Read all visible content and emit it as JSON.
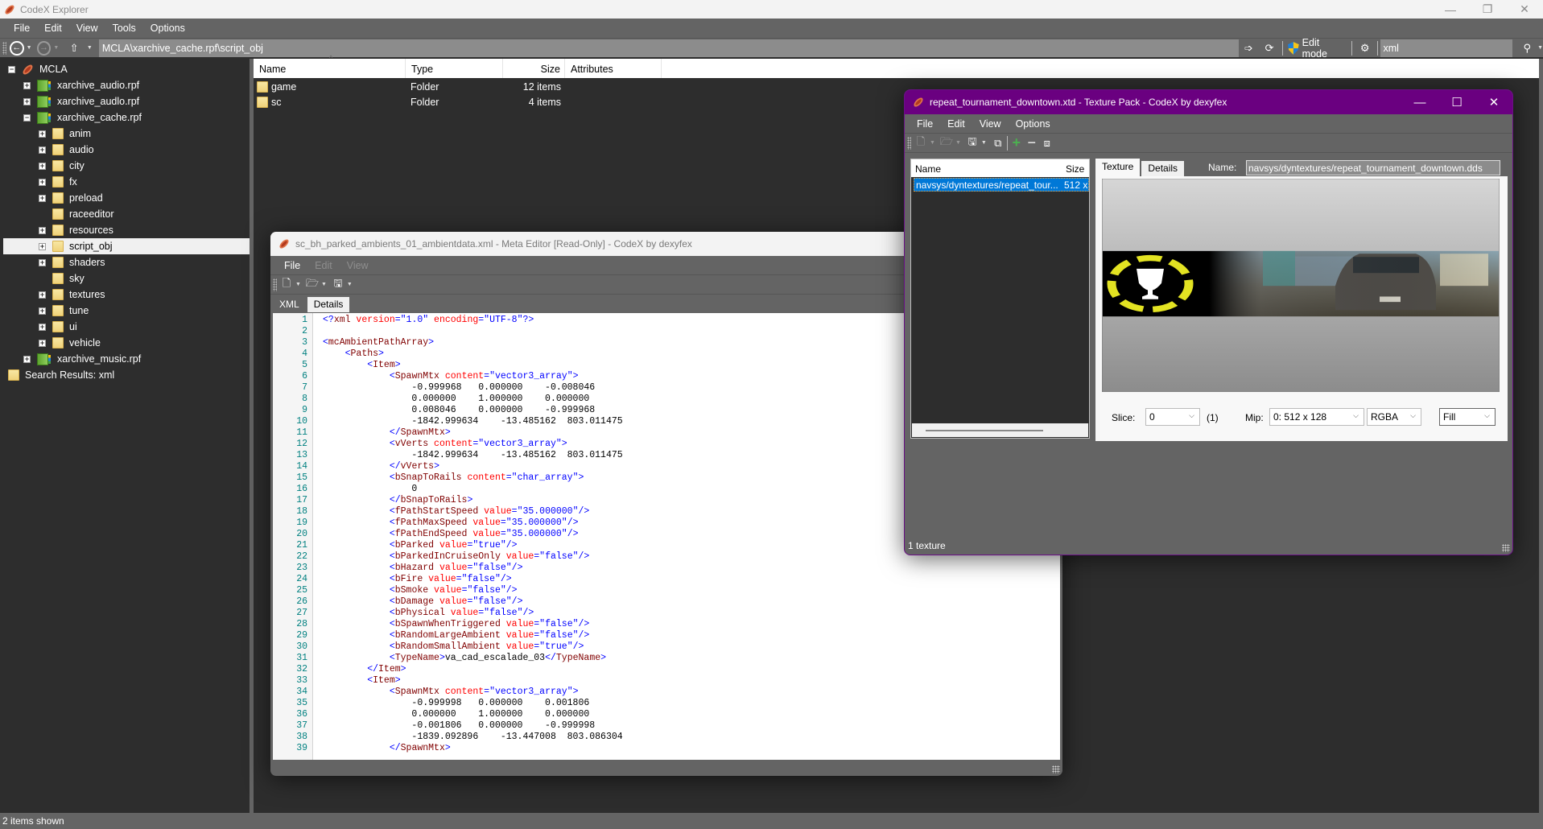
{
  "main": {
    "title": "CodeX Explorer",
    "menu": [
      "File",
      "Edit",
      "View",
      "Tools",
      "Options"
    ],
    "address": "MCLA\\xarchive_cache.rpf\\script_obj",
    "edit_mode_label": "Edit mode",
    "search_value": "xml",
    "status": "2 items shown"
  },
  "tree": [
    {
      "label": "MCLA",
      "level": 0,
      "icon": "hotdog-app-icon",
      "expander": "minus"
    },
    {
      "label": "xarchive_audio.rpf",
      "level": 1,
      "icon": "rpf-archive-icon",
      "expander": "plus"
    },
    {
      "label": "xarchive_audlo.rpf",
      "level": 1,
      "icon": "rpf-archive-icon",
      "expander": "plus"
    },
    {
      "label": "xarchive_cache.rpf",
      "level": 1,
      "icon": "rpf-archive-icon",
      "expander": "minus"
    },
    {
      "label": "anim",
      "level": 2,
      "icon": "folder-icon",
      "expander": "plus"
    },
    {
      "label": "audio",
      "level": 2,
      "icon": "folder-icon",
      "expander": "plus"
    },
    {
      "label": "city",
      "level": 2,
      "icon": "folder-icon",
      "expander": "plus"
    },
    {
      "label": "fx",
      "level": 2,
      "icon": "folder-icon",
      "expander": "plus"
    },
    {
      "label": "preload",
      "level": 2,
      "icon": "folder-icon",
      "expander": "plus"
    },
    {
      "label": "raceeditor",
      "level": 2,
      "icon": "folder-icon",
      "expander": "none"
    },
    {
      "label": "resources",
      "level": 2,
      "icon": "folder-icon",
      "expander": "plus"
    },
    {
      "label": "script_obj",
      "level": 2,
      "icon": "folder-icon",
      "expander": "plus",
      "selected": true
    },
    {
      "label": "shaders",
      "level": 2,
      "icon": "folder-icon",
      "expander": "plus"
    },
    {
      "label": "sky",
      "level": 2,
      "icon": "folder-icon",
      "expander": "none"
    },
    {
      "label": "textures",
      "level": 2,
      "icon": "folder-icon",
      "expander": "plus"
    },
    {
      "label": "tune",
      "level": 2,
      "icon": "folder-icon",
      "expander": "plus"
    },
    {
      "label": "ui",
      "level": 2,
      "icon": "folder-icon",
      "expander": "plus"
    },
    {
      "label": "vehicle",
      "level": 2,
      "icon": "folder-icon",
      "expander": "plus"
    },
    {
      "label": "xarchive_music.rpf",
      "level": 1,
      "icon": "rpf-archive-icon",
      "expander": "plus"
    },
    {
      "label": "Search Results: xml",
      "level": 0,
      "icon": "folder-icon",
      "expander": "none"
    }
  ],
  "filelist": {
    "columns": [
      "Name",
      "Type",
      "Size",
      "Attributes"
    ],
    "rows": [
      {
        "name": "game",
        "type": "Folder",
        "size": "12 items",
        "attributes": ""
      },
      {
        "name": "sc",
        "type": "Folder",
        "size": "4 items",
        "attributes": ""
      }
    ]
  },
  "meta_editor": {
    "title": "sc_bh_parked_ambients_01_ambientdata.xml - Meta Editor [Read-Only] - CodeX by dexyfex",
    "menu": [
      {
        "label": "File",
        "enabled": true
      },
      {
        "label": "Edit",
        "enabled": false
      },
      {
        "label": "View",
        "enabled": false
      }
    ],
    "tabs": [
      "XML",
      "Details"
    ],
    "active_tab": "XML",
    "lines": [
      [
        [
          "b",
          "<?"
        ],
        [
          "t",
          "xml "
        ],
        [
          "a",
          "version"
        ],
        [
          "b",
          "=\"1.0\" "
        ],
        [
          "a",
          "encoding"
        ],
        [
          "b",
          "=\"UTF-8\"?>"
        ]
      ],
      [],
      [
        [
          "b",
          "<"
        ],
        [
          "t",
          "mcAmbientPathArray"
        ],
        [
          "b",
          ">"
        ]
      ],
      [
        [
          "x",
          "    "
        ],
        [
          "b",
          "<"
        ],
        [
          "t",
          "Paths"
        ],
        [
          "b",
          ">"
        ]
      ],
      [
        [
          "x",
          "        "
        ],
        [
          "b",
          "<"
        ],
        [
          "t",
          "Item"
        ],
        [
          "b",
          ">"
        ]
      ],
      [
        [
          "x",
          "            "
        ],
        [
          "b",
          "<"
        ],
        [
          "t",
          "SpawnMtx "
        ],
        [
          "a",
          "content"
        ],
        [
          "b",
          "=\"vector3_array\">"
        ]
      ],
      [
        [
          "x",
          "                -0.999968   0.000000    -0.008046"
        ]
      ],
      [
        [
          "x",
          "                0.000000    1.000000    0.000000"
        ]
      ],
      [
        [
          "x",
          "                0.008046    0.000000    -0.999968"
        ]
      ],
      [
        [
          "x",
          "                -1842.999634    -13.485162  803.011475"
        ]
      ],
      [
        [
          "x",
          "            "
        ],
        [
          "b",
          "</"
        ],
        [
          "t",
          "SpawnMtx"
        ],
        [
          "b",
          ">"
        ]
      ],
      [
        [
          "x",
          "            "
        ],
        [
          "b",
          "<"
        ],
        [
          "t",
          "vVerts "
        ],
        [
          "a",
          "content"
        ],
        [
          "b",
          "=\"vector3_array\">"
        ]
      ],
      [
        [
          "x",
          "                -1842.999634    -13.485162  803.011475"
        ]
      ],
      [
        [
          "x",
          "            "
        ],
        [
          "b",
          "</"
        ],
        [
          "t",
          "vVerts"
        ],
        [
          "b",
          ">"
        ]
      ],
      [
        [
          "x",
          "            "
        ],
        [
          "b",
          "<"
        ],
        [
          "t",
          "bSnapToRails "
        ],
        [
          "a",
          "content"
        ],
        [
          "b",
          "=\"char_array\">"
        ]
      ],
      [
        [
          "x",
          "                0"
        ]
      ],
      [
        [
          "x",
          "            "
        ],
        [
          "b",
          "</"
        ],
        [
          "t",
          "bSnapToRails"
        ],
        [
          "b",
          ">"
        ]
      ],
      [
        [
          "x",
          "            "
        ],
        [
          "b",
          "<"
        ],
        [
          "t",
          "fPathStartSpeed "
        ],
        [
          "a",
          "value"
        ],
        [
          "b",
          "=\"35.000000\"/>"
        ]
      ],
      [
        [
          "x",
          "            "
        ],
        [
          "b",
          "<"
        ],
        [
          "t",
          "fPathMaxSpeed "
        ],
        [
          "a",
          "value"
        ],
        [
          "b",
          "=\"35.000000\"/>"
        ]
      ],
      [
        [
          "x",
          "            "
        ],
        [
          "b",
          "<"
        ],
        [
          "t",
          "fPathEndSpeed "
        ],
        [
          "a",
          "value"
        ],
        [
          "b",
          "=\"35.000000\"/>"
        ]
      ],
      [
        [
          "x",
          "            "
        ],
        [
          "b",
          "<"
        ],
        [
          "t",
          "bParked "
        ],
        [
          "a",
          "value"
        ],
        [
          "b",
          "=\"true\"/>"
        ]
      ],
      [
        [
          "x",
          "            "
        ],
        [
          "b",
          "<"
        ],
        [
          "t",
          "bParkedInCruiseOnly "
        ],
        [
          "a",
          "value"
        ],
        [
          "b",
          "=\"false\"/>"
        ]
      ],
      [
        [
          "x",
          "            "
        ],
        [
          "b",
          "<"
        ],
        [
          "t",
          "bHazard "
        ],
        [
          "a",
          "value"
        ],
        [
          "b",
          "=\"false\"/>"
        ]
      ],
      [
        [
          "x",
          "            "
        ],
        [
          "b",
          "<"
        ],
        [
          "t",
          "bFire "
        ],
        [
          "a",
          "value"
        ],
        [
          "b",
          "=\"false\"/>"
        ]
      ],
      [
        [
          "x",
          "            "
        ],
        [
          "b",
          "<"
        ],
        [
          "t",
          "bSmoke "
        ],
        [
          "a",
          "value"
        ],
        [
          "b",
          "=\"false\"/>"
        ]
      ],
      [
        [
          "x",
          "            "
        ],
        [
          "b",
          "<"
        ],
        [
          "t",
          "bDamage "
        ],
        [
          "a",
          "value"
        ],
        [
          "b",
          "=\"false\"/>"
        ]
      ],
      [
        [
          "x",
          "            "
        ],
        [
          "b",
          "<"
        ],
        [
          "t",
          "bPhysical "
        ],
        [
          "a",
          "value"
        ],
        [
          "b",
          "=\"false\"/>"
        ]
      ],
      [
        [
          "x",
          "            "
        ],
        [
          "b",
          "<"
        ],
        [
          "t",
          "bSpawnWhenTriggered "
        ],
        [
          "a",
          "value"
        ],
        [
          "b",
          "=\"false\"/>"
        ]
      ],
      [
        [
          "x",
          "            "
        ],
        [
          "b",
          "<"
        ],
        [
          "t",
          "bRandomLargeAmbient "
        ],
        [
          "a",
          "value"
        ],
        [
          "b",
          "=\"false\"/>"
        ]
      ],
      [
        [
          "x",
          "            "
        ],
        [
          "b",
          "<"
        ],
        [
          "t",
          "bRandomSmallAmbient "
        ],
        [
          "a",
          "value"
        ],
        [
          "b",
          "=\"true\"/>"
        ]
      ],
      [
        [
          "x",
          "            "
        ],
        [
          "b",
          "<"
        ],
        [
          "t",
          "TypeName"
        ],
        [
          "b",
          ">"
        ],
        [
          "x",
          "va_cad_escalade_03"
        ],
        [
          "b",
          "</"
        ],
        [
          "t",
          "TypeName"
        ],
        [
          "b",
          ">"
        ]
      ],
      [
        [
          "x",
          "        "
        ],
        [
          "b",
          "</"
        ],
        [
          "t",
          "Item"
        ],
        [
          "b",
          ">"
        ]
      ],
      [
        [
          "x",
          "        "
        ],
        [
          "b",
          "<"
        ],
        [
          "t",
          "Item"
        ],
        [
          "b",
          ">"
        ]
      ],
      [
        [
          "x",
          "            "
        ],
        [
          "b",
          "<"
        ],
        [
          "t",
          "SpawnMtx "
        ],
        [
          "a",
          "content"
        ],
        [
          "b",
          "=\"vector3_array\">"
        ]
      ],
      [
        [
          "x",
          "                -0.999998   0.000000    0.001806"
        ]
      ],
      [
        [
          "x",
          "                0.000000    1.000000    0.000000"
        ]
      ],
      [
        [
          "x",
          "                -0.001806   0.000000    -0.999998"
        ]
      ],
      [
        [
          "x",
          "                -1839.092896    -13.447008  803.086304"
        ]
      ],
      [
        [
          "x",
          "            "
        ],
        [
          "b",
          "</"
        ],
        [
          "t",
          "SpawnMtx"
        ],
        [
          "b",
          ">"
        ]
      ]
    ]
  },
  "texture_pack": {
    "title": "repeat_tournament_downtown.xtd - Texture Pack - CodeX by dexyfex",
    "menu": [
      "File",
      "Edit",
      "View",
      "Options"
    ],
    "list_columns": [
      "Name",
      "Size"
    ],
    "list_rows": [
      {
        "name": "navsys/dyntextures/repeat_tour...",
        "size": "512 x"
      }
    ],
    "tabs": [
      "Texture",
      "Details"
    ],
    "active_tab": "Texture",
    "name_label": "Name:",
    "name_value": "navsys/dyntextures/repeat_tournament_downtown.dds",
    "slice_label": "Slice:",
    "slice_value": "0",
    "slice_count": "(1)",
    "mip_label": "Mip:",
    "mip_value": "0: 512 x 128",
    "channel_value": "RGBA",
    "fill_value": "Fill",
    "status": "1 texture"
  },
  "colors": {
    "texture_window_accent": "#6a0080",
    "selection": "#0078d7",
    "trophy_ring": "#e3e322"
  }
}
